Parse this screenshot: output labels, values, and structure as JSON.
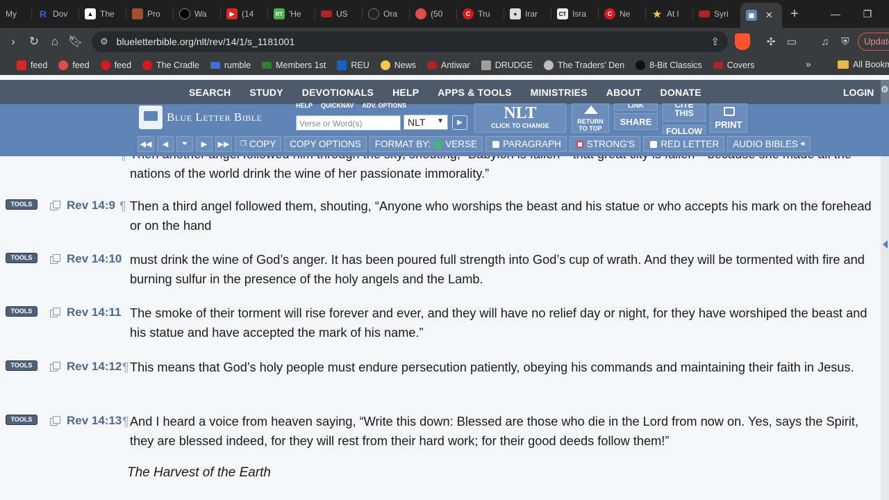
{
  "browser": {
    "tabs": [
      {
        "label": "My",
        "favicon": "tab-icon",
        "color": "#1f1f20"
      },
      {
        "label": "Dov",
        "favicon": "R",
        "color": "#3b5bdb"
      },
      {
        "label": "The",
        "favicon": "shirt",
        "color": "#111111"
      },
      {
        "label": "Pro",
        "favicon": "img",
        "color": "#a0522d"
      },
      {
        "label": "Wa",
        "favicon": "circle",
        "color": "#000000"
      },
      {
        "label": "(14",
        "favicon": "yt",
        "color": "#e02424"
      },
      {
        "label": "'He",
        "favicon": "RT",
        "color": "#4caf50"
      },
      {
        "label": "US",
        "favicon": "flag",
        "color": "#b22222"
      },
      {
        "label": "Ora",
        "favicon": "circle",
        "color": "#222222"
      },
      {
        "label": "(50",
        "favicon": "bulls",
        "color": "#e34a4a"
      },
      {
        "label": "Tru",
        "favicon": "C",
        "color": "#d71920"
      },
      {
        "label": "Irar",
        "favicon": "person",
        "color": "#dddddd"
      },
      {
        "label": "Isra",
        "favicon": "CT",
        "color": "#eeeeee"
      },
      {
        "label": "Ne",
        "favicon": "C",
        "color": "#d71920"
      },
      {
        "label": "At l",
        "favicon": "star",
        "color": "#2e7d32"
      },
      {
        "label": "Syri",
        "favicon": "flag",
        "color": "#b22222"
      }
    ],
    "active_tab_close": "✕",
    "new_tab": "+",
    "url": "blueletterbible.org/nlt/rev/14/1/s_1181001",
    "update_label": "Update",
    "bookmarks": [
      {
        "label": "feed",
        "color": "#e02424"
      },
      {
        "label": "feed",
        "color": "#e34a4a"
      },
      {
        "label": "feed",
        "color": "#d71920"
      },
      {
        "label": "The Cradle",
        "color": "#d71920"
      },
      {
        "label": "rumble",
        "color": "#3c6fd1"
      },
      {
        "label": "Members 1st",
        "color": "#2e7d32"
      },
      {
        "label": "REU",
        "color": "#1565c0"
      },
      {
        "label": "News",
        "color": "#f2c94c"
      },
      {
        "label": "Antiwar",
        "color": "#b22222"
      },
      {
        "label": "DRUDGE",
        "color": "#9e9e9e"
      },
      {
        "label": "The Traders' Den",
        "color": "#bdbdbd"
      },
      {
        "label": "8-Bit Classics",
        "color": "#111111"
      },
      {
        "label": "Covers",
        "color": "#b22222"
      }
    ],
    "bookmarks_more": "»",
    "all_bookmarks": "All Bookm"
  },
  "site": {
    "nav": [
      "SEARCH",
      "STUDY",
      "DEVOTIONALS",
      "HELP",
      "APPS & TOOLS",
      "MINISTRIES",
      "ABOUT",
      "DONATE"
    ],
    "login": "LOGIN",
    "logo": "Blue Letter Bible",
    "mini_links": [
      "HELP",
      "QUICKNAV",
      "ADV. OPTIONS"
    ],
    "search_placeholder": "Verse or Word(s)",
    "version": "NLT",
    "version_big": "NLT",
    "version_small": "CLICK TO CHANGE",
    "return_top": [
      "RETURN",
      "TO TOP"
    ],
    "link": "LINK",
    "share": "SHARE",
    "cite": [
      "CITE",
      "THIS"
    ],
    "follow": "FOLLOW",
    "print": "PRINT",
    "format_bar": {
      "copy": "COPY",
      "copy_options": "COPY OPTIONS",
      "format_by": "FORMAT BY:",
      "verse": "VERSE",
      "paragraph": "PARAGRAPH",
      "strongs": "STRONG'S",
      "red_letter": "RED LETTER",
      "audio": "AUDIO BIBLES"
    }
  },
  "verses": [
    {
      "ref": "",
      "text": "Then another angel followed him through the sky, shouting, “Babylon is fallen—that great city is fallen—because she made all the nations of the world drink the wine of her passionate immorality.”",
      "pil": "¶"
    },
    {
      "ref": "Rev 14:9",
      "text": "Then a third angel followed them, shouting, “Anyone who worships the beast and his statue or who accepts his mark on the forehead or on the hand",
      "pil": "¶"
    },
    {
      "ref": "Rev 14:10",
      "text": "must drink the wine of God’s anger. It has been poured full strength into God’s cup of wrath. And they will be tormented with fire and burning sulfur in the presence of the holy angels and the Lamb.",
      "pil": ""
    },
    {
      "ref": "Rev 14:11",
      "text": "The smoke of their torment will rise forever and ever, and they will have no relief day or night, for they have worshiped the beast and his statue and have accepted the mark of his name.”",
      "pil": ""
    },
    {
      "ref": "Rev 14:12",
      "text": "This means that God’s holy people must endure persecution patiently, obeying his commands and maintaining their faith in Jesus.",
      "pil": "¶"
    },
    {
      "ref": "Rev 14:13",
      "text": "And I heard a voice from heaven saying, “Write this down: Blessed are those who die in the Lord from now on. Yes, says the Spirit, they are blessed indeed, for they will rest from their hard work; for their good deeds follow them!”",
      "pil": "¶"
    }
  ],
  "tools_label": "TOOLS",
  "section_heading": "The Harvest of the Earth",
  "colors": {
    "nav": "#4c5a6b",
    "toolbar": "#5e83b4",
    "ref": "#4c6a8e"
  }
}
